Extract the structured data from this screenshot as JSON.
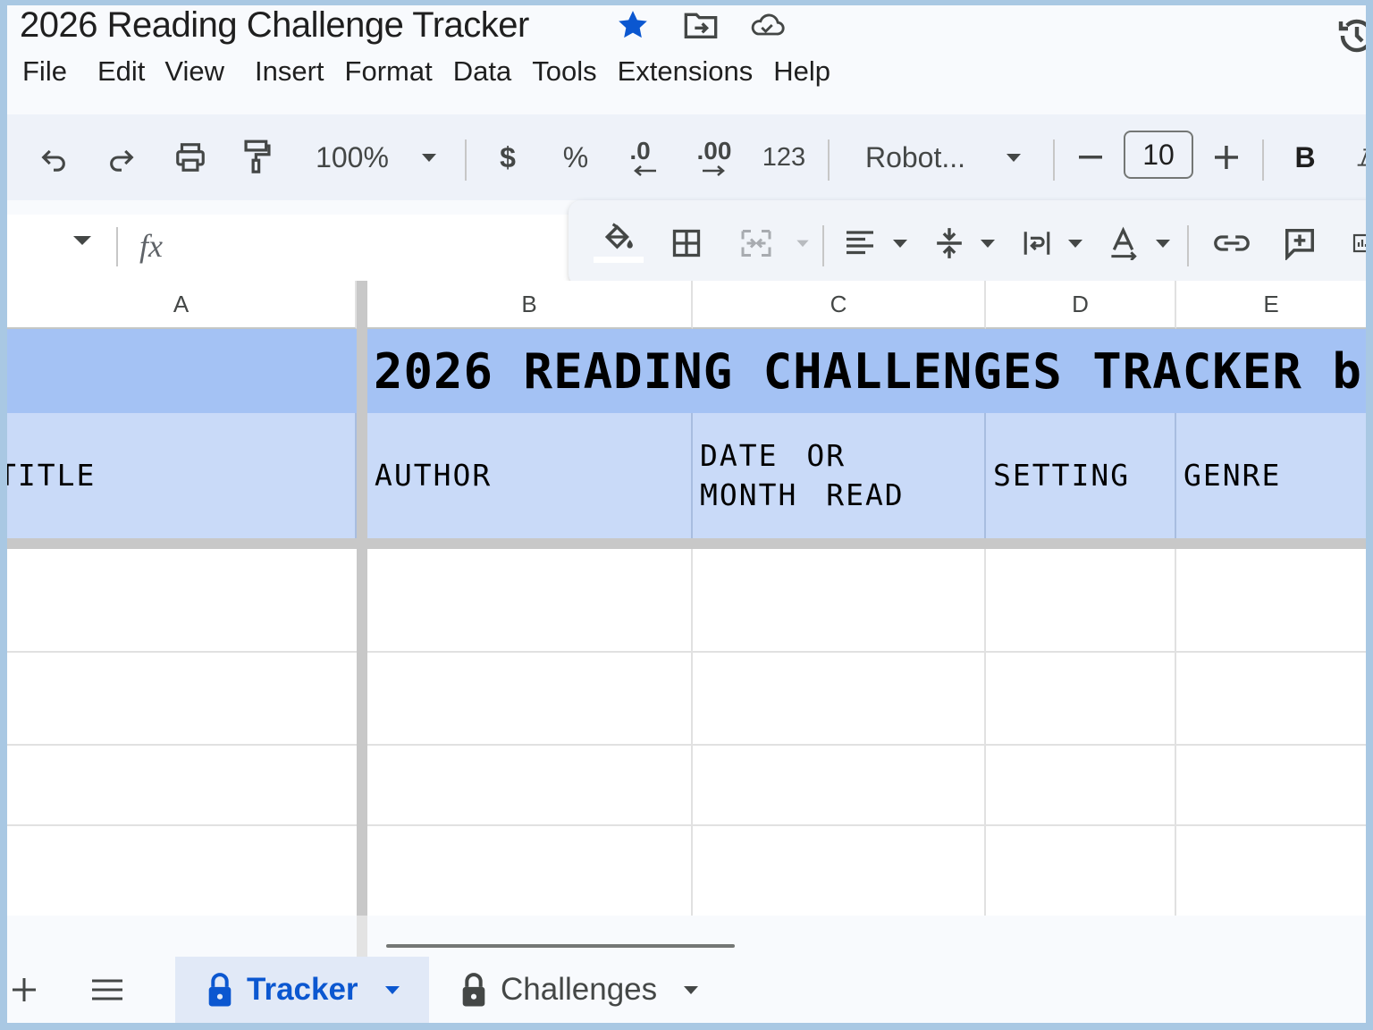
{
  "document": {
    "title": "2026 Reading Challenge Tracker",
    "starred": true,
    "accent_color": "#0b57d0"
  },
  "menu": [
    "File",
    "Edit",
    "View",
    "Insert",
    "Format",
    "Data",
    "Tools",
    "Extensions",
    "Help"
  ],
  "toolbar": {
    "zoom": "100%",
    "currency": "$",
    "percent": "%",
    "decrease_decimal": ".0",
    "increase_decimal": ".00",
    "number_format": "123",
    "font": "Robot...",
    "font_size": "10",
    "bold": "B"
  },
  "formula_bar": {
    "fx": "fx"
  },
  "grid": {
    "columns": [
      "A",
      "B",
      "C",
      "D",
      "E"
    ],
    "banner": "2026 READING CHALLENGES TRACKER b",
    "banner_color": "#a4c2f4",
    "header_color": "#c9daf8",
    "headers": [
      "TITLE",
      "AUTHOR",
      "DATE OR MONTH READ",
      "SETTING",
      "GENRE"
    ]
  },
  "sheets": [
    {
      "name": "Tracker",
      "active": true,
      "locked": true
    },
    {
      "name": "Challenges",
      "active": false,
      "locked": true
    }
  ]
}
